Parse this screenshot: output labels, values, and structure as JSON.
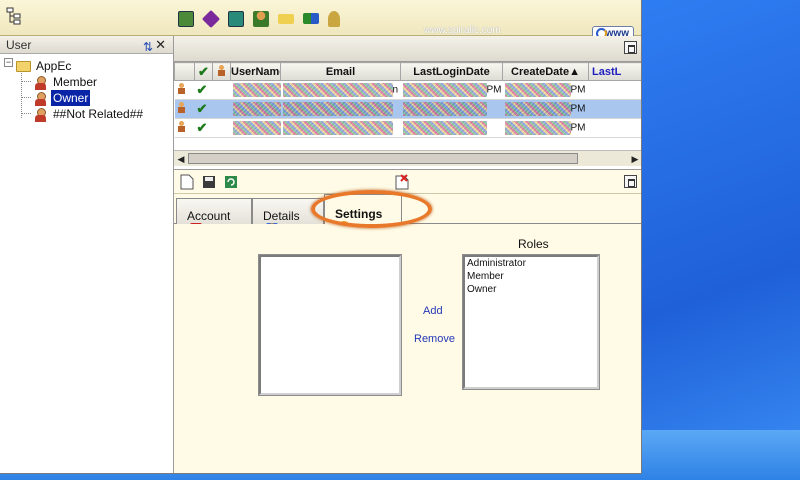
{
  "window": {
    "url_text": "www.spiralic.com",
    "www_button": "www"
  },
  "left_panel": {
    "title": "User",
    "tree": {
      "root": "AppEc",
      "items": [
        {
          "label": "Member",
          "selected": false
        },
        {
          "label": "Owner",
          "selected": true
        },
        {
          "label": "##Not Related##",
          "selected": false
        }
      ]
    }
  },
  "grid": {
    "columns": [
      "UserName",
      "Email",
      "LastLoginDate",
      "CreateDate▲",
      "LastL"
    ],
    "rows": [
      {
        "suffix_email": "n",
        "suffix_login": "PM",
        "suffix_create": "PM",
        "selected": false
      },
      {
        "suffix_email": "",
        "suffix_login": "PM",
        "suffix_create": "PM",
        "selected": true
      },
      {
        "suffix_email": "",
        "suffix_login": "PM",
        "suffix_create": "PM",
        "selected": false
      }
    ]
  },
  "tabs": [
    {
      "label": "Account",
      "active": false
    },
    {
      "label": "Details",
      "active": false
    },
    {
      "label": "Settings",
      "active": true
    }
  ],
  "settings": {
    "roles_title": "Roles",
    "roles": [
      "Administrator",
      "Member",
      "Owner"
    ],
    "add_label": "Add",
    "remove_label": "Remove"
  },
  "colors": {
    "highlight": "#e8782a",
    "selection": "#0a24a8",
    "row_selection": "#a8c6ee",
    "panel_bg": "#fffbe6"
  }
}
